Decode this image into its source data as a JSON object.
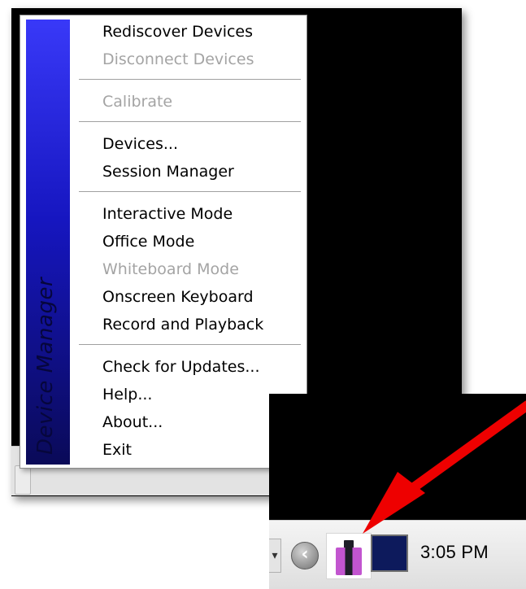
{
  "context_menu": {
    "sidebar_title": "Device Manager",
    "items": [
      {
        "label": "Rediscover Devices",
        "enabled": true
      },
      {
        "label": "Disconnect Devices",
        "enabled": false
      },
      {
        "label": "Calibrate",
        "enabled": false
      },
      {
        "label": "Devices...",
        "enabled": true
      },
      {
        "label": "Session Manager",
        "enabled": true
      },
      {
        "label": "Interactive Mode",
        "enabled": true
      },
      {
        "label": "Office Mode",
        "enabled": true
      },
      {
        "label": "Whiteboard Mode",
        "enabled": false
      },
      {
        "label": "Onscreen Keyboard",
        "enabled": true
      },
      {
        "label": "Record and Playback",
        "enabled": true
      },
      {
        "label": "Check for Updates...",
        "enabled": true
      },
      {
        "label": "Help...",
        "enabled": true
      },
      {
        "label": "About...",
        "enabled": true
      },
      {
        "label": "Exit",
        "enabled": true
      }
    ]
  },
  "taskbar": {
    "clock": "3:05 PM",
    "icons": [
      "expand-hidden-icons-icon",
      "device-manager-tray-icon",
      "square-app-icon"
    ]
  },
  "colors": {
    "sidebar_gradient_top": "#3939f8",
    "sidebar_gradient_bottom": "#0a0a58",
    "disabled_text": "#a4a4a4",
    "arrow": "#ee0000"
  }
}
